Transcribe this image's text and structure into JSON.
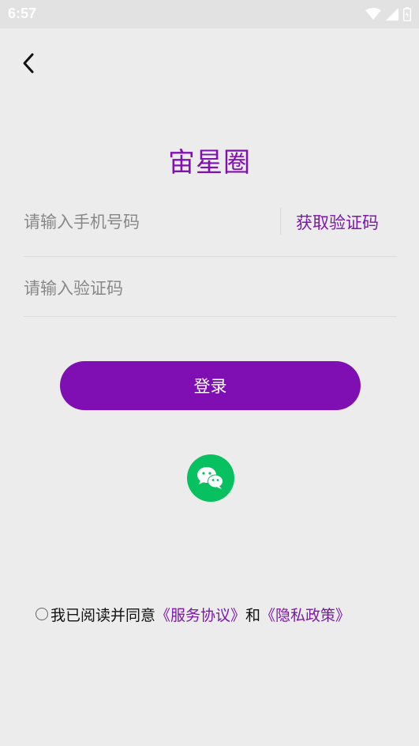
{
  "status_bar": {
    "time": "6:57",
    "icons": [
      "wifi-icon",
      "signal-icon",
      "battery-icon"
    ]
  },
  "colors": {
    "accent": "#7f0fb2",
    "background": "#ececec",
    "wechat_green": "#07c160"
  },
  "header": {
    "back_icon": "chevron-left-icon"
  },
  "app": {
    "title": "宙星圈"
  },
  "form": {
    "phone": {
      "placeholder": "请输入手机号码",
      "value": ""
    },
    "get_code_label": "获取验证码",
    "code": {
      "placeholder": "请输入验证码",
      "value": ""
    },
    "login_label": "登录"
  },
  "social": {
    "wechat_icon": "wechat-icon"
  },
  "agreement": {
    "checked": false,
    "prefix": "我已阅读并同意",
    "service_link": "《服务协议》",
    "conjunction": "和",
    "privacy_link": "《隐私政策》"
  }
}
